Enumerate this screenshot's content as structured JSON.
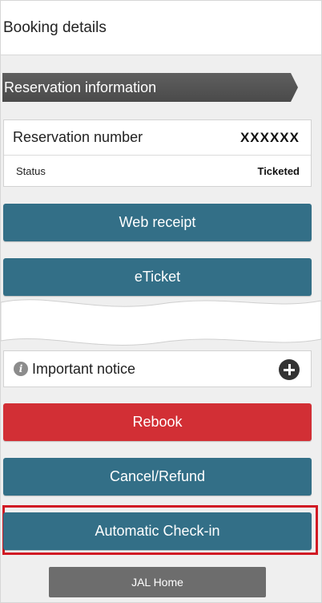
{
  "header": {
    "title": "Booking details"
  },
  "reservation": {
    "section_label": "Reservation information",
    "number_label": "Reservation number",
    "number_value": "XXXXXX",
    "status_label": "Status",
    "status_value": "Ticketed"
  },
  "buttons": {
    "web_receipt": "Web receipt",
    "eticket": "eTicket",
    "rebook": "Rebook",
    "cancel_refund": "Cancel/Refund",
    "auto_checkin": "Automatic Check-in",
    "jal_home": "JAL Home"
  },
  "notice": {
    "label": "Important notice",
    "icon": "info-icon",
    "expand_icon": "plus-icon"
  },
  "colors": {
    "teal": "#336f87",
    "red": "#d22f35",
    "highlight": "#d11a24",
    "gray_button": "#6d6d6d",
    "section_bar": "#555555"
  }
}
